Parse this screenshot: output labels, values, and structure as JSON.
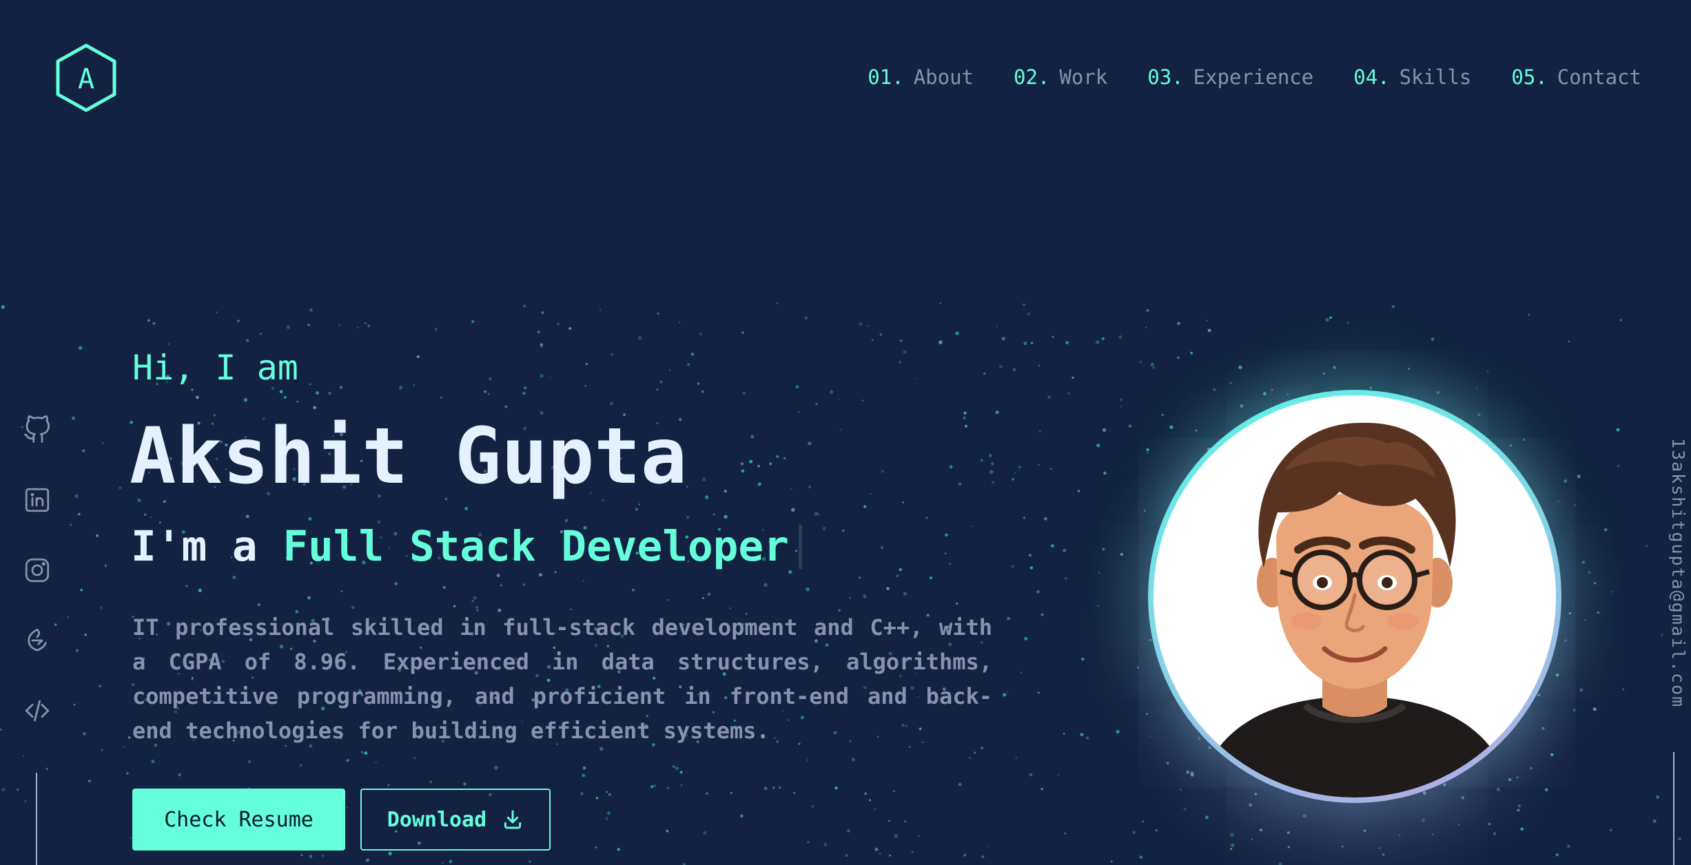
{
  "header": {
    "logo_letter": "A",
    "nav": [
      {
        "num": "01.",
        "label": "About"
      },
      {
        "num": "02.",
        "label": "Work"
      },
      {
        "num": "03.",
        "label": "Experience"
      },
      {
        "num": "04.",
        "label": "Skills"
      },
      {
        "num": "05.",
        "label": "Contact"
      }
    ]
  },
  "social": [
    "github-icon",
    "linkedin-icon",
    "instagram-icon",
    "codechef-icon",
    "code-icon"
  ],
  "email": "13akshitgupta@gmail.com",
  "hero": {
    "greeting": "Hi, I am",
    "name": "Akshit Gupta",
    "role_prefix": "I'm a ",
    "role_title": "Full Stack Developer",
    "bio": "IT professional skilled in full-stack development and C++, with a CGPA of 8.96. Experienced in data structures, algorithms, competitive programming, and proficient in front-end and back-end technologies for building efficient systems.",
    "buttons": {
      "resume": "Check Resume",
      "download": "Download"
    }
  },
  "colors": {
    "background": "#132242",
    "accent": "#64ffda",
    "heading": "#e6f1ff",
    "muted": "#8892b0"
  }
}
